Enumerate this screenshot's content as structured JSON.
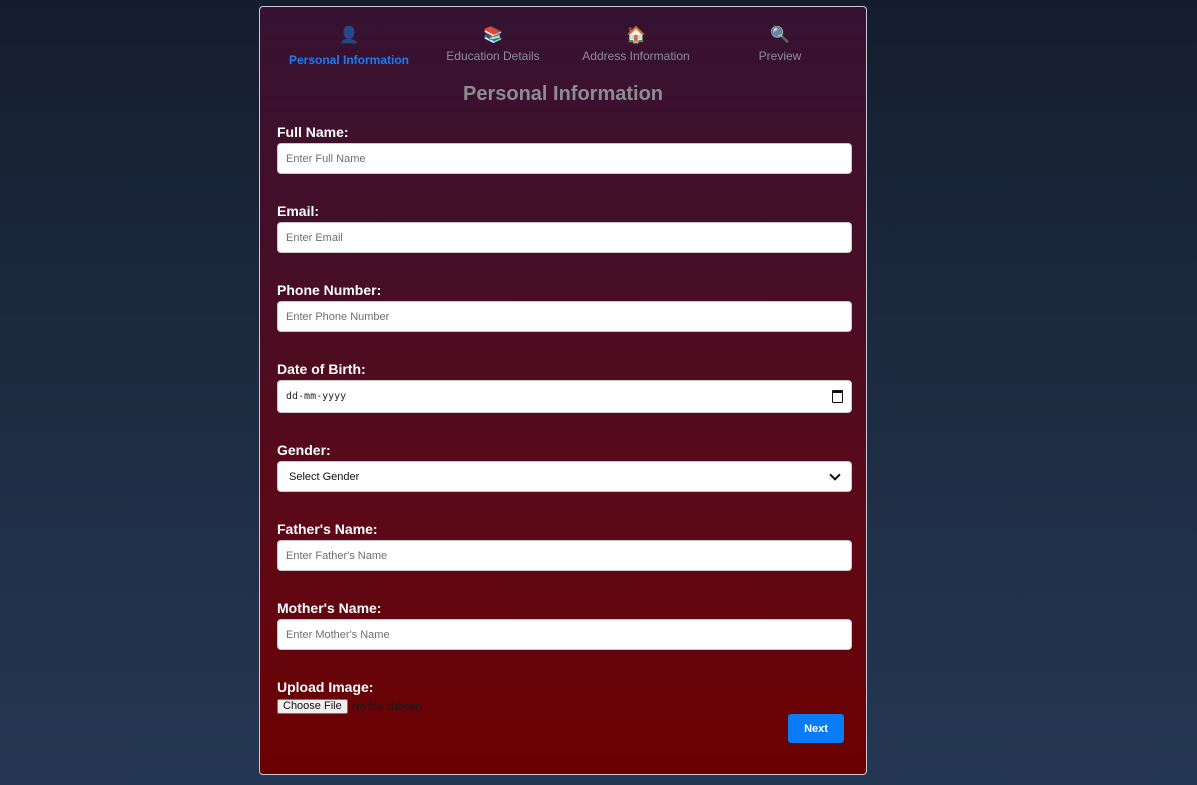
{
  "steps": [
    {
      "icon": "👤",
      "label": "Personal Information"
    },
    {
      "icon": "📚",
      "label": "Education Details"
    },
    {
      "icon": "🏠",
      "label": "Address Information"
    },
    {
      "icon": "🔍",
      "label": "Preview"
    }
  ],
  "page_title": "Personal Information",
  "fields": {
    "full_name": {
      "label": "Full Name:",
      "placeholder": "Enter Full Name"
    },
    "email": {
      "label": "Email:",
      "placeholder": "Enter Email"
    },
    "phone": {
      "label": "Phone Number:",
      "placeholder": "Enter Phone Number"
    },
    "dob": {
      "label": "Date of Birth:",
      "value": "dd-mm-yyyy"
    },
    "gender": {
      "label": "Gender:",
      "selected": "Select Gender"
    },
    "father": {
      "label": "Father's Name:",
      "placeholder": "Enter Father's Name"
    },
    "mother": {
      "label": "Mother's Name:",
      "placeholder": "Enter Mother's Name"
    },
    "image": {
      "label": "Upload Image:",
      "button": "Choose File",
      "status": "No file chosen"
    }
  },
  "buttons": {
    "next": "Next"
  },
  "colors": {
    "active_step": "#1d7cf2",
    "primary_button": "#0a7cf8"
  }
}
